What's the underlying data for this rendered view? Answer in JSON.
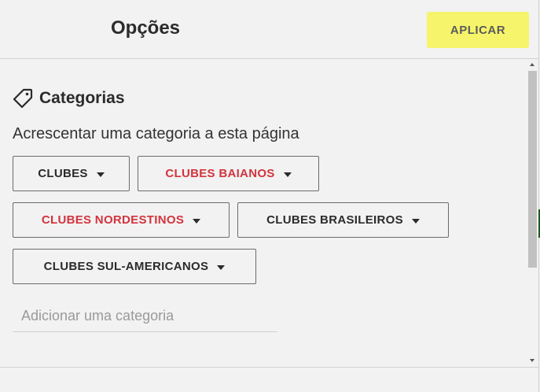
{
  "header": {
    "title": "Opções",
    "apply_label": "APLICAR",
    "apply_color": "#f6f46a"
  },
  "categories": {
    "icon": "tag-icon",
    "title": "Categorias",
    "description": "Acrescentar uma categoria a esta página",
    "chips": [
      {
        "label": "CLUBES",
        "color": "#2b2b2b"
      },
      {
        "label": "CLUBES BAIANOS",
        "color": "#d2343d"
      },
      {
        "label": "CLUBES NORDESTINOS",
        "color": "#d2343d"
      },
      {
        "label": "CLUBES BRASILEIROS",
        "color": "#2b2b2b"
      },
      {
        "label": "CLUBES SUL-AMERICANOS",
        "color": "#2b2b2b"
      }
    ],
    "add_placeholder": "Adicionar uma categoria",
    "add_value": ""
  }
}
